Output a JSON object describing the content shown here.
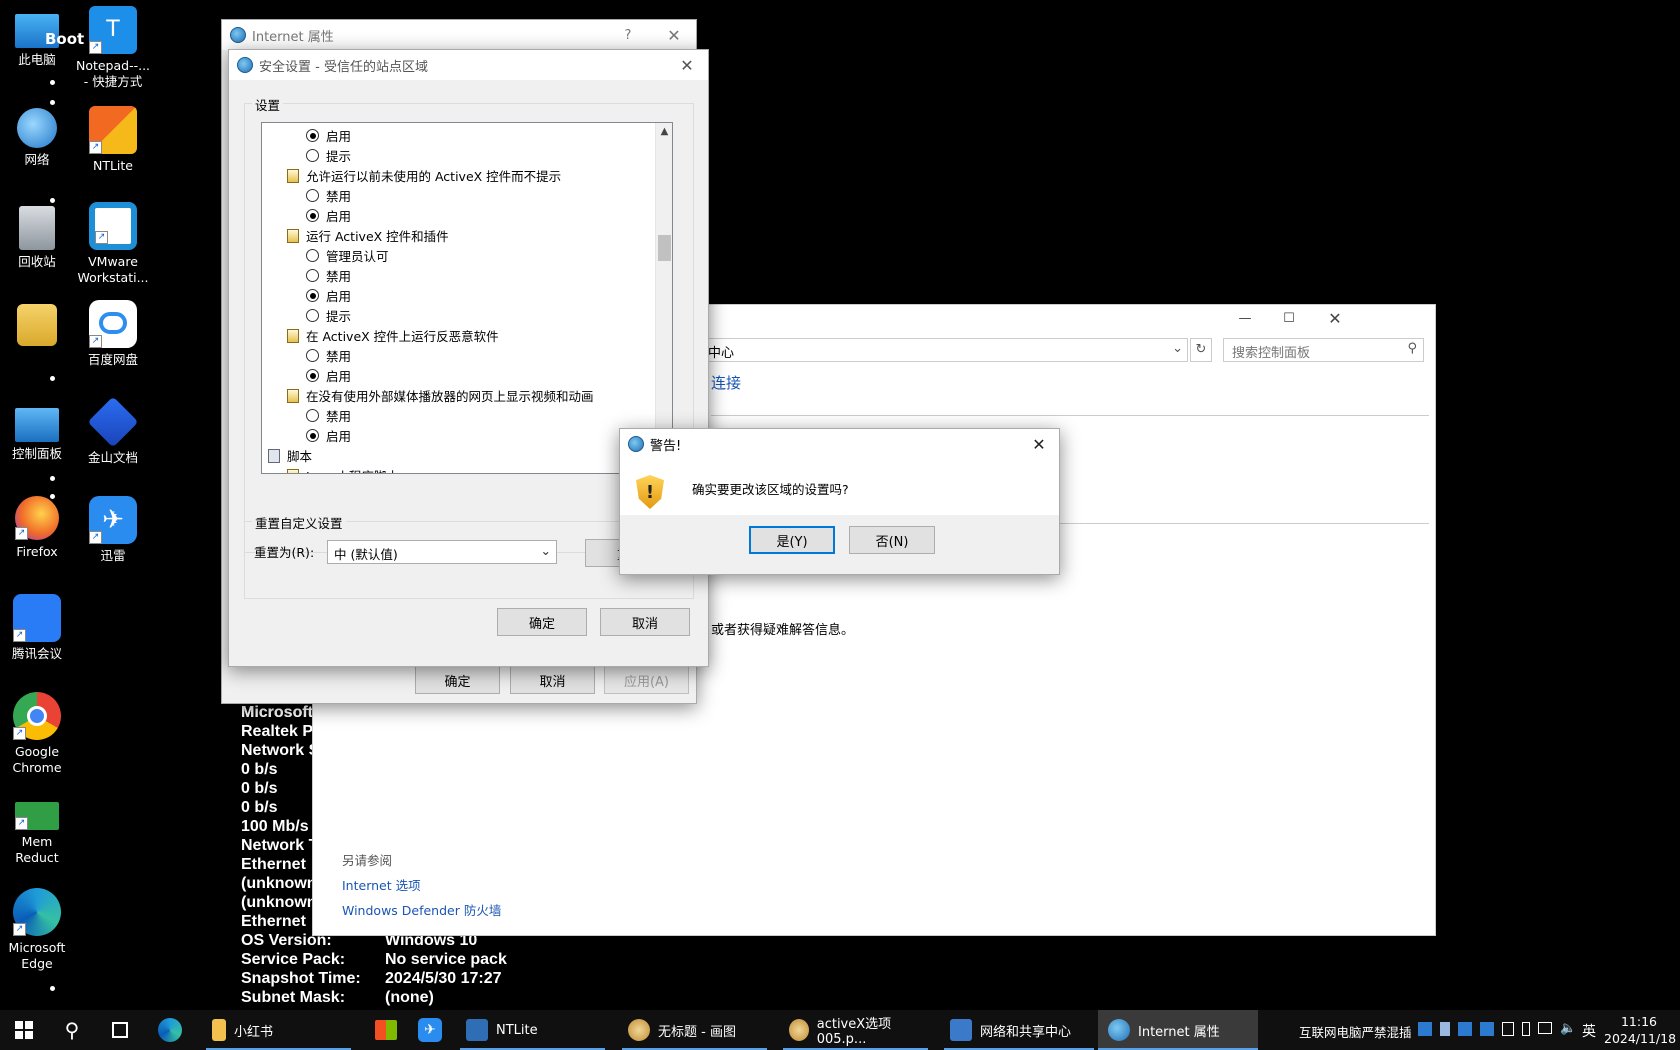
{
  "desktop": {
    "icons": [
      {
        "label": "此电脑"
      },
      {
        "label": "Notepad--...\n- 快捷方式"
      },
      {
        "label": "网络"
      },
      {
        "label": "NTLite"
      },
      {
        "label": "回收站"
      },
      {
        "label": "VMware\nWorkstati..."
      },
      {
        "label": ""
      },
      {
        "label": "百度网盘"
      },
      {
        "label": "控制面板"
      },
      {
        "label": "金山文档"
      },
      {
        "label": "Firefox"
      },
      {
        "label": "迅雷"
      },
      {
        "label": "腾讯会议"
      },
      {
        "label": "Google\nChrome"
      },
      {
        "label": "Mem\nReduct"
      },
      {
        "label": "Microsoft\nEdge"
      }
    ],
    "overlay_text": "Boot"
  },
  "bginfo": {
    "partial_lines": [
      "Microsoft",
      "Realtek P",
      "Network S",
      "0 b/s",
      "0 b/s",
      "0 b/s",
      "100 Mb/s",
      "Network T",
      "Ethernet",
      "(unknown",
      "(unknown",
      "Ethernet"
    ],
    "rows": [
      {
        "k": "OS Version:",
        "v": "Windows 10"
      },
      {
        "k": "Service Pack:",
        "v": "No service pack"
      },
      {
        "k": "Snapshot Time:",
        "v": "2024/5/30 17:27"
      },
      {
        "k": "Subnet Mask:",
        "v": "(none)"
      }
    ]
  },
  "control_panel": {
    "address_text": "中心",
    "search_placeholder": "搜索控制面板",
    "link_connect": "连接",
    "help_text": "或者获得疑难解答信息。",
    "see_also_title": "另请参阅",
    "see_also_links": [
      "Internet 选项",
      "Windows Defender 防火墙"
    ]
  },
  "inet_props": {
    "title": "Internet 属性",
    "help": "?",
    "ok": "确定",
    "cancel": "取消",
    "apply": "应用(A)"
  },
  "security": {
    "title": "安全设置 - 受信任的站点区域",
    "group_label": "设置",
    "items": [
      {
        "type": "radio",
        "label": "启用",
        "on": true
      },
      {
        "type": "radio",
        "label": "提示",
        "on": false
      },
      {
        "type": "header",
        "label": "允许运行以前未使用的 ActiveX 控件而不提示"
      },
      {
        "type": "radio",
        "label": "禁用",
        "on": false
      },
      {
        "type": "radio",
        "label": "启用",
        "on": true
      },
      {
        "type": "header",
        "label": "运行 ActiveX 控件和插件"
      },
      {
        "type": "radio",
        "label": "管理员认可",
        "on": false
      },
      {
        "type": "radio",
        "label": "禁用",
        "on": false
      },
      {
        "type": "radio",
        "label": "启用",
        "on": true
      },
      {
        "type": "radio",
        "label": "提示",
        "on": false
      },
      {
        "type": "header",
        "label": "在 ActiveX 控件上运行反恶意软件"
      },
      {
        "type": "radio",
        "label": "禁用",
        "on": false
      },
      {
        "type": "radio",
        "label": "启用",
        "on": true
      },
      {
        "type": "header",
        "label": "在没有使用外部媒体播放器的网页上显示视频和动画"
      },
      {
        "type": "radio",
        "label": "禁用",
        "on": false
      },
      {
        "type": "radio",
        "label": "启用",
        "on": true
      },
      {
        "type": "section",
        "label": "脚本"
      },
      {
        "type": "header",
        "label": "Java 小程序脚本"
      }
    ],
    "reset_group": "重置自定义设置",
    "reset_to_label": "重置为(R):",
    "reset_select": "中 (默认值)",
    "reset_button": "重置",
    "ok": "确定",
    "cancel": "取消"
  },
  "warning": {
    "title": "警告!",
    "message": "确实要更改该区域的设置吗?",
    "yes": "是(Y)",
    "no": "否(N)"
  },
  "taskbar": {
    "items": [
      {
        "label": "小红书",
        "color": "#f2c14e"
      },
      {
        "label": "",
        "color": "#3b7bd6"
      },
      {
        "label": "",
        "color": "#2a8cf0"
      },
      {
        "label": "NTLite",
        "color": "#2f6db5"
      },
      {
        "label": "无标题 - 画图",
        "color": "#d3a54d"
      },
      {
        "label": "activeX选项005.p...",
        "color": "#d3a54d"
      },
      {
        "label": "网络和共享中心",
        "color": "#3a7ac9"
      },
      {
        "label": "Internet 属性",
        "color": "#4d96d8"
      }
    ],
    "tray_text": "互联网电脑严禁混插",
    "ime": "英",
    "time": "11:16",
    "date": "2024/11/18"
  }
}
